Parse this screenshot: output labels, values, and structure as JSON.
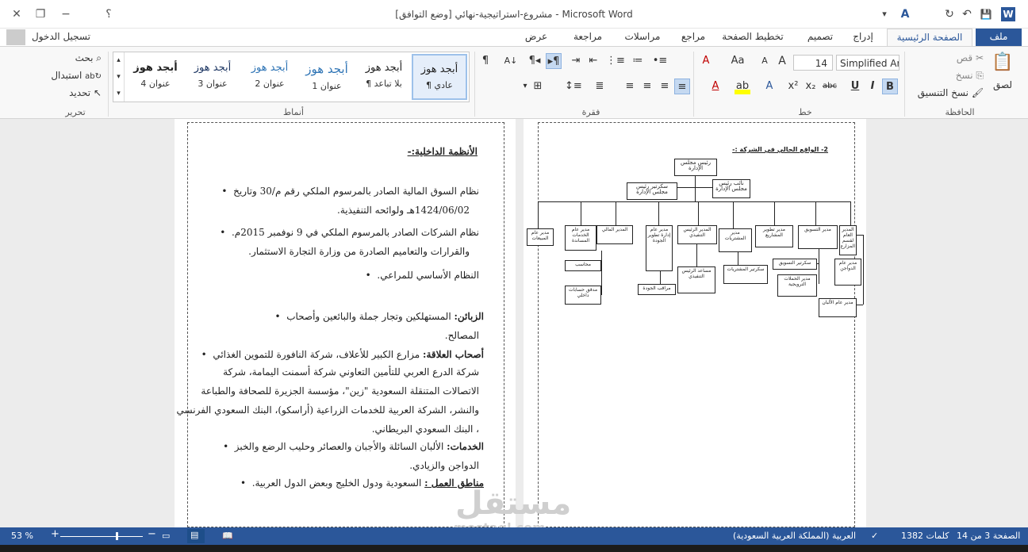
{
  "window": {
    "title": "مشروع-استراتيجية-نهائي [وضع التوافق] - Microsoft Word",
    "help": "؟",
    "minimize": "−",
    "restore": "❐",
    "close": "✕"
  },
  "qat": {
    "save": "💾",
    "undo": "↶",
    "redo": "↻",
    "word_icon": "W"
  },
  "tabs": {
    "file": "ملف",
    "home": "الصفحة الرئيسية",
    "insert": "إدراج",
    "design": "تصميم",
    "layout": "تخطيط الصفحة",
    "references": "مراجع",
    "mailings": "مراسلات",
    "review": "مراجعة",
    "view": "عرض",
    "signin": "تسجيل الدخول"
  },
  "clipboard": {
    "paste": "لصق",
    "cut": "قص",
    "copy": "نسخ",
    "format_painter": "نسخ التنسيق",
    "group": "الحافظة"
  },
  "font": {
    "name": "Simplified Ara",
    "size": "14",
    "group": "خط",
    "grow": "A",
    "shrink": "A",
    "aa": "Aa",
    "clear": "A"
  },
  "paragraph": {
    "group": "فقرة"
  },
  "styles": {
    "group": "أنماط",
    "items": [
      {
        "preview": "أبجد هوز",
        "name": "¶ عادي"
      },
      {
        "preview": "أبجد هوز",
        "name": "¶ بلا تباعد"
      },
      {
        "preview": "أبجد هوز",
        "name": "عنوان 1"
      },
      {
        "preview": "أبجد هوز",
        "name": "عنوان 2"
      },
      {
        "preview": "أبجد هوز",
        "name": "عنوان 3"
      },
      {
        "preview": "أبجد هوز",
        "name": "عنوان 4"
      }
    ]
  },
  "editing": {
    "find": "بحث",
    "replace": "استبدال",
    "select": "تحديد",
    "group": "تحرير"
  },
  "left_page": {
    "heading": "الأنظمة الداخلية:-",
    "b1_l1": "نظام السوق المالية الصادر بالمرسوم الملكي رقم م/30 وتاريخ",
    "b1_l2": "1424/06/02هـ ولوائحه التنفيذية.",
    "b2_l1": "نظام الشركات الصادر بالمرسوم الملكي في 9 نوفمبر 2015م.",
    "b2_l2": "والقرارات والتعاميم الصادرة من وزارة التجارة الاستثمار.",
    "b3": "النظام الأساسي للمراعي.",
    "c1_label": "الزبائن:",
    "c1_text": " المستهلكين وتجار جملة والبائعين وأصحاب",
    "c1_l2": "المصالح.",
    "c2_label": "أصحاب العلاقة:",
    "c2_text": " مزارع الكبير للأعلاف، شركة النافورة للتموين الغذائي",
    "c2_l2": "شركة الدرع العربي للتأمين التعاوني شركة أسمنت اليمامة، شركة",
    "c2_l3": "الاتصالات المتنقلة السعودية \"زين\"، مؤسسة الجزيرة للصحافة والطباعة",
    "c2_l4": "والنشر، الشركة العربية للخدمات الزراعية (أراسكو)، البنك السعودي الفرنسي",
    "c2_l5": "، البنك السعودي البريطاني.",
    "c3_label": "الخدمات:",
    "c3_text": " الألبان السائلة والأجبان والعصائر وحليب الرضع والخبز",
    "c3_l2": "الدواجن والزيادي.",
    "c4_label": "مناطق العمل :",
    "c4_text": " السعودية ودول الخليج وبعض الدول العربية."
  },
  "right_page": {
    "heading": "2- الواقع الحالي في الشركة :-",
    "chair": "رئيس مجلس الإدارة",
    "secretary": "سكرتير رئيس مجلس الإدارة",
    "vice": "نائب رئيس مجلس الإدارة",
    "exec_mgr": "المدير الرئيس التنفيذي",
    "fin_mgr": "المدير المالي",
    "internal_audit_mgr": "مدير عام الخدمات المساندة",
    "sales_mgr": "مدير عام المبيعات",
    "quality_mgr": "مدير عام إدارة تطوير الجودة",
    "purch_mgr": "مدير المشتريات",
    "projects_mgr": "مدير تطوير المشاريع",
    "marketing_mgr": "مدير التسويق",
    "farm_mgr": "المدير العام لقسم المزارع",
    "accountant": "محاسب",
    "auditor": "مدقق حسابات داخلي",
    "quality_inspector": "مراقب الجودة",
    "exec_asst": "مساعد الرئيس التنفيذي",
    "purch_secretary": "سكرتير المشتريات",
    "marketing_secretary": "سكرتير التسويق",
    "campaign_mgr": "مدير الحملات الترويجية",
    "poultry_mgr": "مدير عام الدواجن",
    "dairy_mgr": "مدير عام الألبان"
  },
  "status": {
    "page": "الصفحة 3 من 14",
    "words": "1382 كلمات",
    "language": "العربية (المملكة العربية السعودية)",
    "zoom": "53 %"
  },
  "watermark": {
    "ar": "مستقل",
    "en": "mostaql.com"
  }
}
